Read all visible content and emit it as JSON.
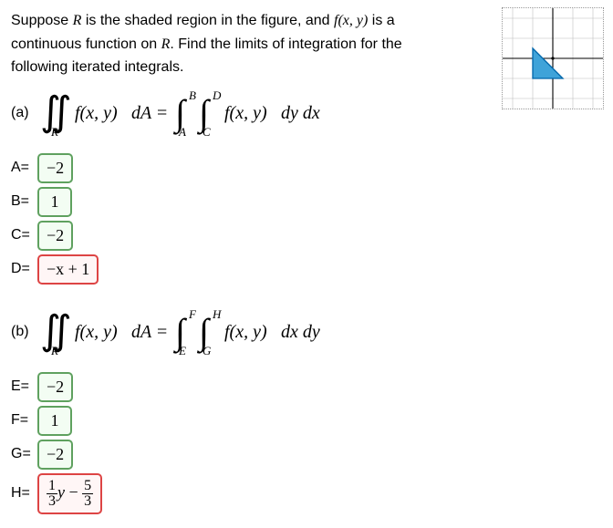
{
  "prompt": {
    "line1_a": "Suppose ",
    "R": "R",
    "line1_b": " is the shaded region in the figure, and ",
    "fxy": "f(x, y)",
    "line1_c": " is a continuous function on ",
    "R2": "R",
    "line1_d": ". Find the limits of integration for the following iterated integrals."
  },
  "parts": {
    "a_label": "(a)",
    "b_label": "(b)"
  },
  "bounds_a": {
    "A": "A",
    "B": "B",
    "C": "C",
    "D": "D"
  },
  "bounds_b": {
    "E": "E",
    "F": "F",
    "G": "G",
    "H": "H"
  },
  "eq_parts": {
    "dA_eq": "dA =",
    "dy_dx": "dy dx",
    "dx_dy": "dx dy",
    "fxy": "f(x, y)",
    "R_sub": "R"
  },
  "answers": {
    "A_label": "A=",
    "A_val": "−2",
    "B_label": "B=",
    "B_val": "1",
    "C_label": "C=",
    "C_val": "−2",
    "D_label": "D=",
    "D_val": "−x + 1",
    "E_label": "E=",
    "E_val": "−2",
    "F_label": "F=",
    "F_val": "1",
    "G_label": "G=",
    "G_val": "−2",
    "H_label": "H=",
    "H_frac1_num": "1",
    "H_frac1_den": "3",
    "H_mid_y": "y",
    "H_minus": " − ",
    "H_frac2_num": "5",
    "H_frac2_den": "3"
  },
  "chart_data": {
    "type": "area",
    "title": "",
    "xlabel": "",
    "ylabel": "",
    "xlim": [
      -4,
      4
    ],
    "ylim": [
      -4,
      4
    ],
    "region_vertices": [
      [
        -2,
        -2
      ],
      [
        -2,
        1
      ],
      [
        1,
        -2
      ]
    ],
    "description": "Triangular shaded region R with vertices at (-2,-2), (-2,1), (1,-2), hypotenuse y = -x - 1 ... but per answers line is y = -x + 1 scaled"
  }
}
